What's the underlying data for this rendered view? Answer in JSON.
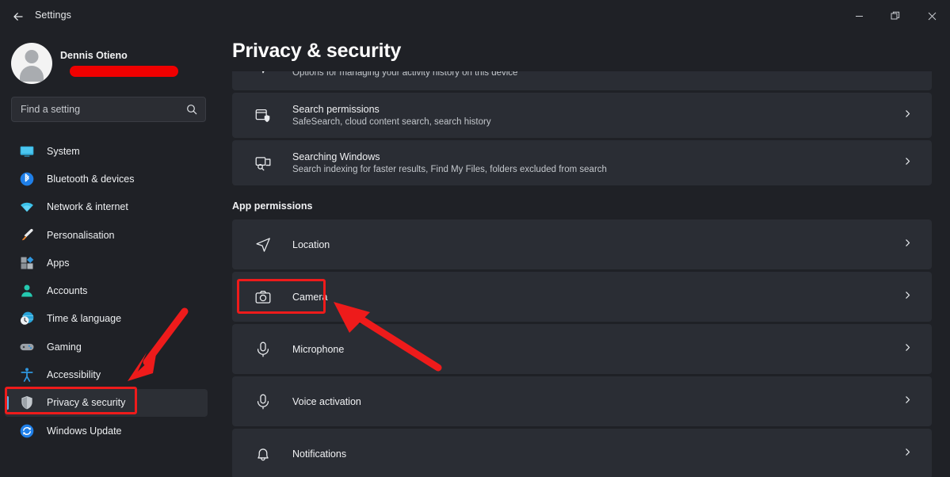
{
  "window": {
    "app_title": "Settings",
    "back_icon": "back-arrow-icon",
    "controls": {
      "minimize": "minimize-icon",
      "restore": "restore-icon",
      "close": "close-icon"
    }
  },
  "sidebar": {
    "account": {
      "name": "Dennis Otieno",
      "email_redacted": true,
      "avatar_icon": "person-avatar-icon"
    },
    "search": {
      "placeholder": "Find a setting",
      "icon": "search-icon"
    },
    "items": [
      {
        "label": "System",
        "icon": "monitor-icon",
        "selected": false
      },
      {
        "label": "Bluetooth & devices",
        "icon": "bluetooth-icon",
        "selected": false
      },
      {
        "label": "Network & internet",
        "icon": "wifi-icon",
        "selected": false
      },
      {
        "label": "Personalisation",
        "icon": "paintbrush-icon",
        "selected": false
      },
      {
        "label": "Apps",
        "icon": "apps-icon",
        "selected": false
      },
      {
        "label": "Accounts",
        "icon": "account-icon",
        "selected": false
      },
      {
        "label": "Time & language",
        "icon": "clock-globe-icon",
        "selected": false
      },
      {
        "label": "Gaming",
        "icon": "gamepad-icon",
        "selected": false
      },
      {
        "label": "Accessibility",
        "icon": "accessibility-icon",
        "selected": false
      },
      {
        "label": "Privacy & security",
        "icon": "shield-icon",
        "selected": true
      },
      {
        "label": "Windows Update",
        "icon": "update-icon",
        "selected": false
      }
    ]
  },
  "main": {
    "title": "Privacy & security",
    "rows_top": [
      {
        "title": "",
        "subtitle": "Options for managing your activity history on this device",
        "icon": "activity-history-icon",
        "cut_off": true
      },
      {
        "title": "Search permissions",
        "subtitle": "SafeSearch, cloud content search, search history",
        "icon": "search-permissions-icon",
        "cut_off": false
      },
      {
        "title": "Searching Windows",
        "subtitle": "Search indexing for faster results, Find My Files, folders excluded from search",
        "icon": "searching-windows-icon",
        "cut_off": false
      }
    ],
    "section_title": "App permissions",
    "permissions": [
      {
        "title": "Location",
        "icon": "location-icon",
        "highlighted": false
      },
      {
        "title": "Camera",
        "icon": "camera-icon",
        "highlighted": true
      },
      {
        "title": "Microphone",
        "icon": "microphone-icon",
        "highlighted": false
      },
      {
        "title": "Voice activation",
        "icon": "voice-icon",
        "highlighted": false
      },
      {
        "title": "Notifications",
        "icon": "bell-icon",
        "highlighted": false
      }
    ],
    "chevron_icon": "chevron-right-icon"
  },
  "annotations": {
    "color": "#ee1b1b",
    "highlight_boxes": [
      {
        "target": "sidebar-item-privacy-security"
      },
      {
        "target": "permission-row-camera"
      }
    ],
    "arrows": [
      {
        "points_to": "sidebar-item-privacy-security",
        "direction": "down-left"
      },
      {
        "points_to": "permission-row-camera",
        "direction": "up-left"
      }
    ]
  }
}
